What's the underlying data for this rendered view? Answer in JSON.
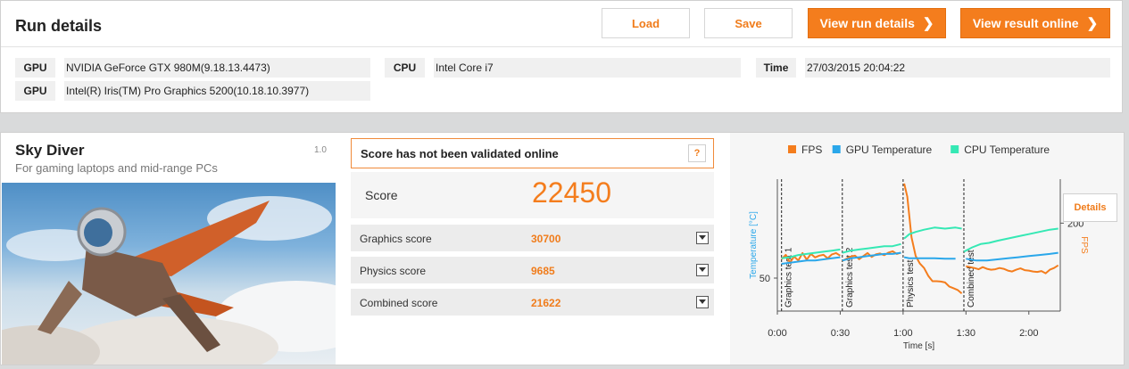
{
  "run": {
    "title": "Run details",
    "buttons": {
      "load": "Load",
      "save": "Save",
      "view_run_details": "View run details",
      "view_result_online": "View result online",
      "chevron": "❯"
    },
    "info": [
      {
        "label": "GPU",
        "value": "NVIDIA GeForce GTX 980M(9.18.13.4473)"
      },
      {
        "label": "GPU",
        "value": "Intel(R) Iris(TM) Pro Graphics 5200(10.18.10.3977)"
      },
      {
        "label": "CPU",
        "value": "Intel Core i7"
      },
      {
        "label": "Time",
        "value": "27/03/2015 20:04:22"
      }
    ]
  },
  "benchmark": {
    "name": "Sky Diver",
    "subtitle": "For gaming laptops and mid-range PCs",
    "version": "1.0",
    "validation": "Score has not been validated online",
    "help": "?",
    "score_label": "Score",
    "score": "22450",
    "subscores": [
      {
        "label": "Graphics score",
        "value": "30700"
      },
      {
        "label": "Physics score",
        "value": "9685"
      },
      {
        "label": "Combined score",
        "value": "21622"
      }
    ],
    "details": "Details"
  },
  "colors": {
    "accent": "#f47d1d",
    "fps": "#f47d1d",
    "gpu_temp": "#2aa7ea",
    "cpu_temp": "#35e8b4"
  },
  "chart_data": {
    "type": "line",
    "legend": [
      "FPS",
      "GPU Temperature",
      "CPU Temperature"
    ],
    "legend_position": "top",
    "xlabel": "Time [s]",
    "ylabel_left": "Temperature [°C]",
    "ylabel_right": "FPS",
    "xticks": [
      "0:00",
      "0:30",
      "1:00",
      "1:30",
      "2:00"
    ],
    "yticks_left": [
      "50"
    ],
    "yticks_right": [
      "200"
    ],
    "xlim": [
      0,
      135
    ],
    "ylim_left": [
      35,
      95
    ],
    "ylim_right": [
      0,
      300
    ],
    "sections": [
      {
        "label": "Graphics test 1",
        "start": 2
      },
      {
        "label": "Graphics test 2",
        "start": 31
      },
      {
        "label": "Physics test",
        "start": 60
      },
      {
        "label": "Combined test",
        "start": 89
      }
    ],
    "series": [
      {
        "name": "FPS",
        "axis": "right",
        "x": [
          2,
          4,
          6,
          8,
          10,
          12,
          14,
          16,
          18,
          20,
          22,
          24,
          26,
          28,
          30,
          31,
          33,
          35,
          37,
          39,
          41,
          43,
          45,
          47,
          49,
          51,
          53,
          55,
          57,
          59,
          60.5,
          62,
          63,
          64,
          66,
          68,
          70,
          72,
          74,
          76,
          78,
          80,
          82,
          84,
          86,
          88,
          90,
          92,
          94,
          96,
          98,
          100,
          102,
          104,
          106,
          108,
          110,
          112,
          114,
          116,
          118,
          120,
          122,
          124,
          126,
          128,
          130,
          132,
          134
        ],
        "y": [
          118,
          128,
          110,
          124,
          115,
          132,
          117,
          130,
          122,
          126,
          128,
          120,
          129,
          132,
          126,
          114,
          119,
          124,
          126,
          118,
          125,
          132,
          123,
          129,
          131,
          127,
          133,
          136,
          130,
          133,
          290,
          260,
          215,
          168,
          125,
          108,
          98,
          80,
          68,
          68,
          67,
          65,
          56,
          52,
          48,
          40,
          102,
          100,
          98,
          95,
          100,
          96,
          94,
          95,
          98,
          96,
          92,
          90,
          94,
          97,
          93,
          92,
          90,
          89,
          91,
          86,
          94,
          98,
          104
        ]
      },
      {
        "name": "GPU Temperature",
        "axis": "left",
        "x": [
          2,
          6,
          10,
          14,
          18,
          22,
          26,
          30,
          31,
          35,
          39,
          43,
          47,
          51,
          55,
          59,
          60.5,
          63,
          66,
          70,
          75,
          80,
          85,
          90,
          95,
          100,
          105,
          110,
          115,
          120,
          125,
          130,
          134
        ],
        "y": [
          56.5,
          57,
          57.5,
          58,
          58,
          58.5,
          59,
          59.5,
          58,
          59,
          59.5,
          60,
          60.5,
          61,
          61,
          61.5,
          59.5,
          59,
          59,
          59,
          59,
          58.8,
          58.8,
          58.8,
          58,
          58,
          58.5,
          59,
          59.5,
          60,
          60.5,
          61,
          61.5
        ]
      },
      {
        "name": "CPU Temperature",
        "axis": "left",
        "x": [
          2,
          6,
          10,
          14,
          18,
          22,
          26,
          30,
          31,
          35,
          39,
          43,
          47,
          51,
          55,
          59,
          60.5,
          63,
          66,
          70,
          75,
          80,
          85,
          88,
          89,
          93,
          97,
          101,
          105,
          110,
          115,
          120,
          125,
          130,
          134
        ],
        "y": [
          59,
          59.5,
          60.5,
          61,
          61.5,
          62,
          62.5,
          63,
          61.5,
          62.5,
          63,
          63.5,
          64,
          64.5,
          64.5,
          65.5,
          68,
          70,
          71,
          72,
          73,
          72.5,
          73,
          72.5,
          62,
          64,
          65.5,
          66,
          67,
          68,
          69,
          70,
          71,
          72,
          72.5
        ]
      }
    ]
  }
}
